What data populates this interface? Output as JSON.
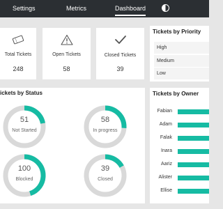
{
  "nav": {
    "items": [
      "Settings",
      "Metrics",
      "Dashboard"
    ],
    "active": "Dashboard"
  },
  "kpis": [
    {
      "icon": "ticket-icon",
      "label": "Total Tickets",
      "value": "248"
    },
    {
      "icon": "warning-icon",
      "label": "Open Tickets",
      "value": "58"
    },
    {
      "icon": "checkmark-icon",
      "label": "Closed Tickets",
      "value": "39"
    }
  ],
  "priority": {
    "title": "Tickets by Priority",
    "levels": [
      "High",
      "Medium",
      "Low"
    ]
  },
  "status": {
    "title": "ickets by Status",
    "items": [
      {
        "value": "51",
        "label": "Not Started",
        "fraction": 0.22
      },
      {
        "value": "58",
        "label": "In progress",
        "fraction": 0.26
      },
      {
        "value": "100",
        "label": "Blocked",
        "fraction": 0.45
      },
      {
        "value": "39",
        "label": "Closed",
        "fraction": 0.17
      }
    ]
  },
  "owner": {
    "title": "Tickets by Owner",
    "names": [
      "Fabian",
      "Adam",
      "Falak",
      "Inara",
      "Aariz",
      "Alister",
      "Ellise"
    ]
  },
  "colors": {
    "accent": "#16bba3",
    "ring": "#d9d9d9",
    "topbar": "#2b2f33",
    "background": "#e6e6e6"
  }
}
